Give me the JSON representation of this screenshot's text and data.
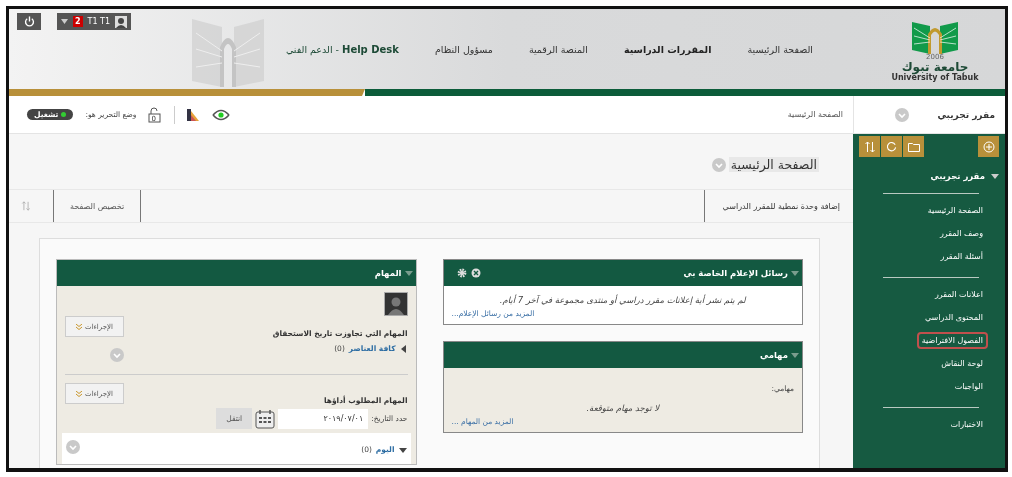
{
  "header": {
    "logo": {
      "year": "2006",
      "name_ar": "جامعة تبوك",
      "name_en": "University of Tabuk"
    },
    "nav": [
      {
        "label": "الصفحة الرئيسية",
        "selected": false
      },
      {
        "label": "المقررات الدراسية",
        "selected": true
      },
      {
        "label": "المنصة الرقمية",
        "selected": false
      },
      {
        "label": "مسؤول النظام",
        "selected": false
      },
      {
        "label": "**Help Desk** - الدعم الفني",
        "selected": false
      }
    ],
    "user_menu": {
      "notification_count": "2",
      "user_name": "T1 T1"
    }
  },
  "toolbar": {
    "course_name": "مقرر تجريبي",
    "breadcrumb": "الصفحة الرئيسية",
    "edit_mode": {
      "label": "وضع التحرير هو:",
      "state_label": "تشغيل",
      "on": true
    },
    "lock_count": "0"
  },
  "page": {
    "title": "الصفحة الرئيسية",
    "add_module_label": "إضافة وحدة نمطية للمقرر الدراسي",
    "customize_label": "تخصيص الصفحة"
  },
  "tasks_module": {
    "title": "المهام",
    "sections": [
      {
        "heading": "المهام التي تجاوزت تاريخ الاستحقاق",
        "actions_label": "الإجراءات",
        "groups": [
          {
            "label": "كافة العناصر",
            "count": "(0)",
            "expanded": false
          }
        ]
      },
      {
        "heading": "المهام المطلوب أداؤها",
        "actions_label": "الإجراءات",
        "date_label": "حدد التاريخ:",
        "date_value": "٢٠١٩/٠٧/٠١",
        "go_label": "انتقل",
        "groups": [
          {
            "label": "اليوم",
            "count": "(0)",
            "expanded": true
          }
        ]
      }
    ]
  },
  "modules": [
    {
      "kind": "announcements",
      "title": "رسائل الإعلام الخاصة بي",
      "message": "لم يتم نشر أية إعلانات مقرر دراسي أو منتدى مجموعة في آخر 7 أيام.",
      "more_link": "المزيد من رسائل الإعلام..."
    },
    {
      "kind": "tasks",
      "title": "مهامي",
      "label": "مهامي:",
      "message": "لا توجد مهام متوقعة.",
      "more_link": "المزيد من المهام ..."
    }
  ],
  "sidebar": {
    "course": {
      "label": "مقرر تجريبي",
      "expanded": true
    },
    "groups": [
      {
        "items": [
          {
            "label": "الصفحة الرئيسية",
            "highlighted": false
          },
          {
            "label": "وصف المقرر",
            "highlighted": false
          },
          {
            "label": "أسئلة المقرر",
            "highlighted": false
          }
        ]
      },
      {
        "items": [
          {
            "label": "اعلانات المقرر",
            "highlighted": false
          },
          {
            "label": "المحتوى الدراسي",
            "highlighted": false
          },
          {
            "label": "الفصول الافتراضية",
            "highlighted": true
          },
          {
            "label": "لوحة النقاش",
            "highlighted": false
          },
          {
            "label": "الواجبات",
            "highlighted": false
          }
        ]
      },
      {
        "items": [
          {
            "label": "الاختبارات",
            "highlighted": false
          }
        ]
      }
    ]
  }
}
